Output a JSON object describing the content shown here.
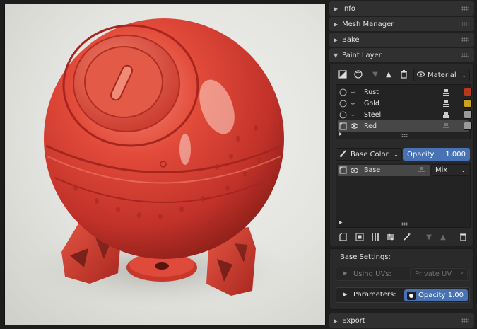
{
  "sections": {
    "info": "Info",
    "mesh_manager": "Mesh Manager",
    "bake": "Bake",
    "paint_layer": "Paint Layer",
    "export": "Export"
  },
  "toolbar": {
    "material_dropdown": "Material"
  },
  "layers": [
    {
      "name": "Rust",
      "color": "#b8391c"
    },
    {
      "name": "Gold",
      "color": "#c8a21a"
    },
    {
      "name": "Steel",
      "color": "#9a9a9a"
    },
    {
      "name": "Red",
      "color": "#9a9a9a",
      "selected": true
    }
  ],
  "channel": {
    "dropdown": "Base Color",
    "opacity_label": "Opacity",
    "opacity_value": "1.000"
  },
  "sublayers": [
    {
      "name": "Base",
      "blend": "Mix"
    }
  ],
  "base_settings": {
    "title": "Base Settings:",
    "using_uvs_label": "Using UVs:",
    "using_uvs_value": "Private UV",
    "parameters_label": "Parameters:",
    "opacity_label": "Opacity",
    "opacity_value": "1.00"
  },
  "colors": {
    "accent": "#4772b3",
    "model_red": "#e0483a"
  }
}
